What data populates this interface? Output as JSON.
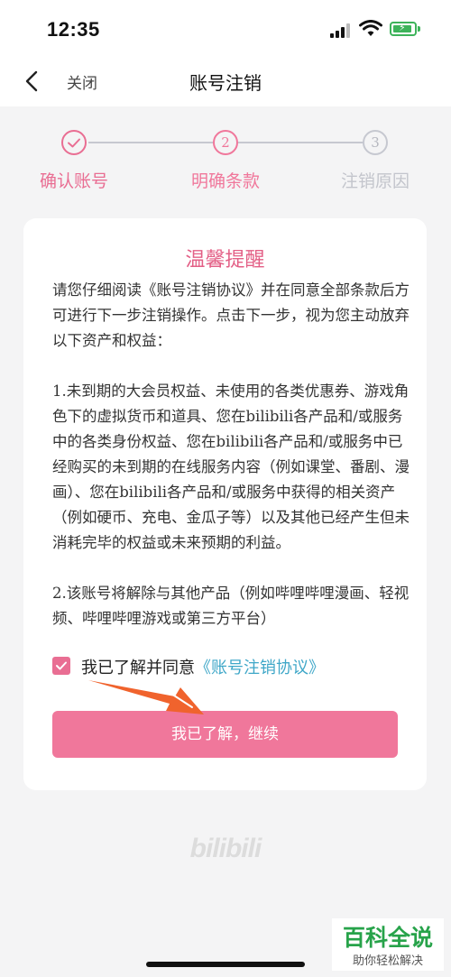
{
  "status_bar": {
    "time": "12:35"
  },
  "nav": {
    "close_label": "关闭",
    "title": "账号注销"
  },
  "steps": [
    {
      "number": "",
      "label": "确认账号",
      "state": "done"
    },
    {
      "number": "2",
      "label": "明确条款",
      "state": "active"
    },
    {
      "number": "3",
      "label": "注销原因",
      "state": "pending"
    }
  ],
  "card": {
    "title": "温馨提醒",
    "paragraphs": [
      "请您仔细阅读《账号注销协议》并在同意全部条款后方可进行下一步注销操作。点击下一步，视为您主动放弃以下资产和权益：",
      "1.未到期的大会员权益、未使用的各类优惠券、游戏角色下的虚拟货币和道具、您在bilibili各产品和/或服务中的各类身份权益、您在bilibili各产品和/或服务中已经购买的未到期的在线服务内容（例如课堂、番剧、漫画）、您在bilibili各产品和/或服务中获得的相关资产（例如硬币、充电、金瓜子等）以及其他已经产生但未消耗完毕的权益或未来预期的利益。",
      "2.该账号将解除与其他产品（例如哔哩哔哩漫画、轻视频、哔哩哔哩游戏或第三方平台）"
    ],
    "agree_prefix": "我已了解并同意",
    "agree_link": "《账号注销协议》",
    "agree_checked": true,
    "continue_label": "我已了解，继续"
  },
  "brand_logo": "bilibili",
  "watermark": {
    "title": "百科全说",
    "subtitle": "助你轻松解决"
  },
  "colors": {
    "accent": "#f0779b",
    "title_pink": "#e35f86",
    "link": "#3fa7c8",
    "arrow": "#f0632d",
    "watermark_green": "#27a34a"
  }
}
